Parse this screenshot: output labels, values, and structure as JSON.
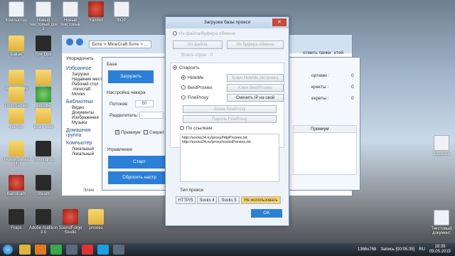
{
  "desktop_icons": [
    {
      "label": "Компьютер",
      "style": "docico"
    },
    {
      "label": "Новый текстовый док 3",
      "style": "docico"
    },
    {
      "label": "Новый текстовый",
      "style": "docico"
    },
    {
      "label": "Yandex",
      "style": "redico"
    },
    {
      "label": "ФОР",
      "style": "docico"
    },
    {
      "label": "Бакан",
      "style": "folder"
    },
    {
      "label": "Fire Ops",
      "style": "dark"
    },
    {
      "label": "steem-proxy",
      "style": "folder"
    },
    {
      "label": "Ссылки",
      "style": "folder"
    },
    {
      "label": "Prog games",
      "style": "folder"
    },
    {
      "label": "Google Chrome",
      "style": "greenico"
    },
    {
      "label": "Games",
      "style": "folder"
    },
    {
      "label": "Боже мой",
      "style": "folder"
    },
    {
      "label": "Новая папка (4)",
      "style": "folder"
    },
    {
      "label": "FiveNights",
      "style": "dark"
    },
    {
      "label": "Bandicam",
      "style": "redico"
    },
    {
      "label": "Steam",
      "style": "dark"
    },
    {
      "label": "Fraps",
      "style": "dark"
    },
    {
      "label": "Adobe Audition 3.0",
      "style": "dark"
    },
    {
      "label": "SoundForge Studio",
      "style": "redico"
    },
    {
      "label": "proxies",
      "style": "folder"
    },
    {
      "label": "Корзина",
      "style": "docico"
    },
    {
      "label": "Текстовый документ",
      "style": "docico"
    }
  ],
  "explorer": {
    "path": "Боте > MineCraft Боте > ...",
    "organize": "Упорядочить",
    "favorites": "Избранное",
    "nav_items": [
      "Загрузки",
      "Недавние места",
      "Рабочий стол",
      ".minecraft",
      "Movies"
    ],
    "libraries": "Библиотеки",
    "lib_items": [
      "Видео",
      "Документы",
      "Изображения",
      "Музыка"
    ],
    "homegroup": "Домашняя группа",
    "computer": "Компьютер",
    "computer_items": [
      "Локальный",
      "Локальный"
    ],
    "status": "Элем"
  },
  "main_app": {
    "base_label": "База",
    "load_button": "Загрузить",
    "settings_title": "Настройка чекера",
    "threads_label": "Потоков:",
    "threads_value": "50",
    "separator_label": "Разделитель:",
    "separator_value": ":",
    "premium_label": "Премиум",
    "secret_label": "Секрет",
    "control_label": "Управление",
    "start_button": "Старт",
    "reset_button": "Сбросить настр",
    "right_tabs": [
      "отметь пачки",
      "ктей"
    ],
    "counters": [
      {
        "label": "ортами :",
        "value": "0"
      },
      {
        "label": "кректы :",
        "value": "0"
      },
      {
        "label": "екреты :",
        "value": "0"
      }
    ],
    "table_header": "Премиум"
  },
  "proxy_dialog": {
    "title": "Загрузка базы прокси",
    "close": "✕",
    "from_file_label": "Из файла/буфера обмена",
    "from_file_button": "Из файла",
    "from_clipboard_button": "Из буфера обмена",
    "total_lines": "Всего строк : 0",
    "parse_label": "Спарсить",
    "sources": [
      {
        "name": "HideMe",
        "button": "Ключ HideMe (встроен)",
        "checked": true,
        "enabled": false
      },
      {
        "name": "BestProxies",
        "button": "Ключ BestProxies",
        "checked": false,
        "enabled": false
      },
      {
        "name": "FineProxy",
        "button": "Сменить IP на свой",
        "checked": false,
        "enabled": true
      }
    ],
    "login_field": "Логин FineProxy",
    "password_field": "Пароль FineProxy",
    "links_label": "По ссылкам",
    "links": [
      "http://socks24.ru/proxy/httpProxies.txt",
      "http://socks24.ru/proxy/socksProxies.txt"
    ],
    "proxy_type_label": "Тип прокси",
    "proxy_types": [
      "HTTP/S",
      "Socks 4",
      "Socks 5",
      "Не использовать"
    ],
    "ok_button": "OK"
  },
  "taskbar": {
    "recording": "Запись [00:05:35]",
    "resolution": "1366x768",
    "lang": "RU",
    "time": "18:39",
    "date": "09.05.2015"
  },
  "colors": {
    "accent": "#2c7fd6",
    "highlight": "#f6d36b"
  }
}
